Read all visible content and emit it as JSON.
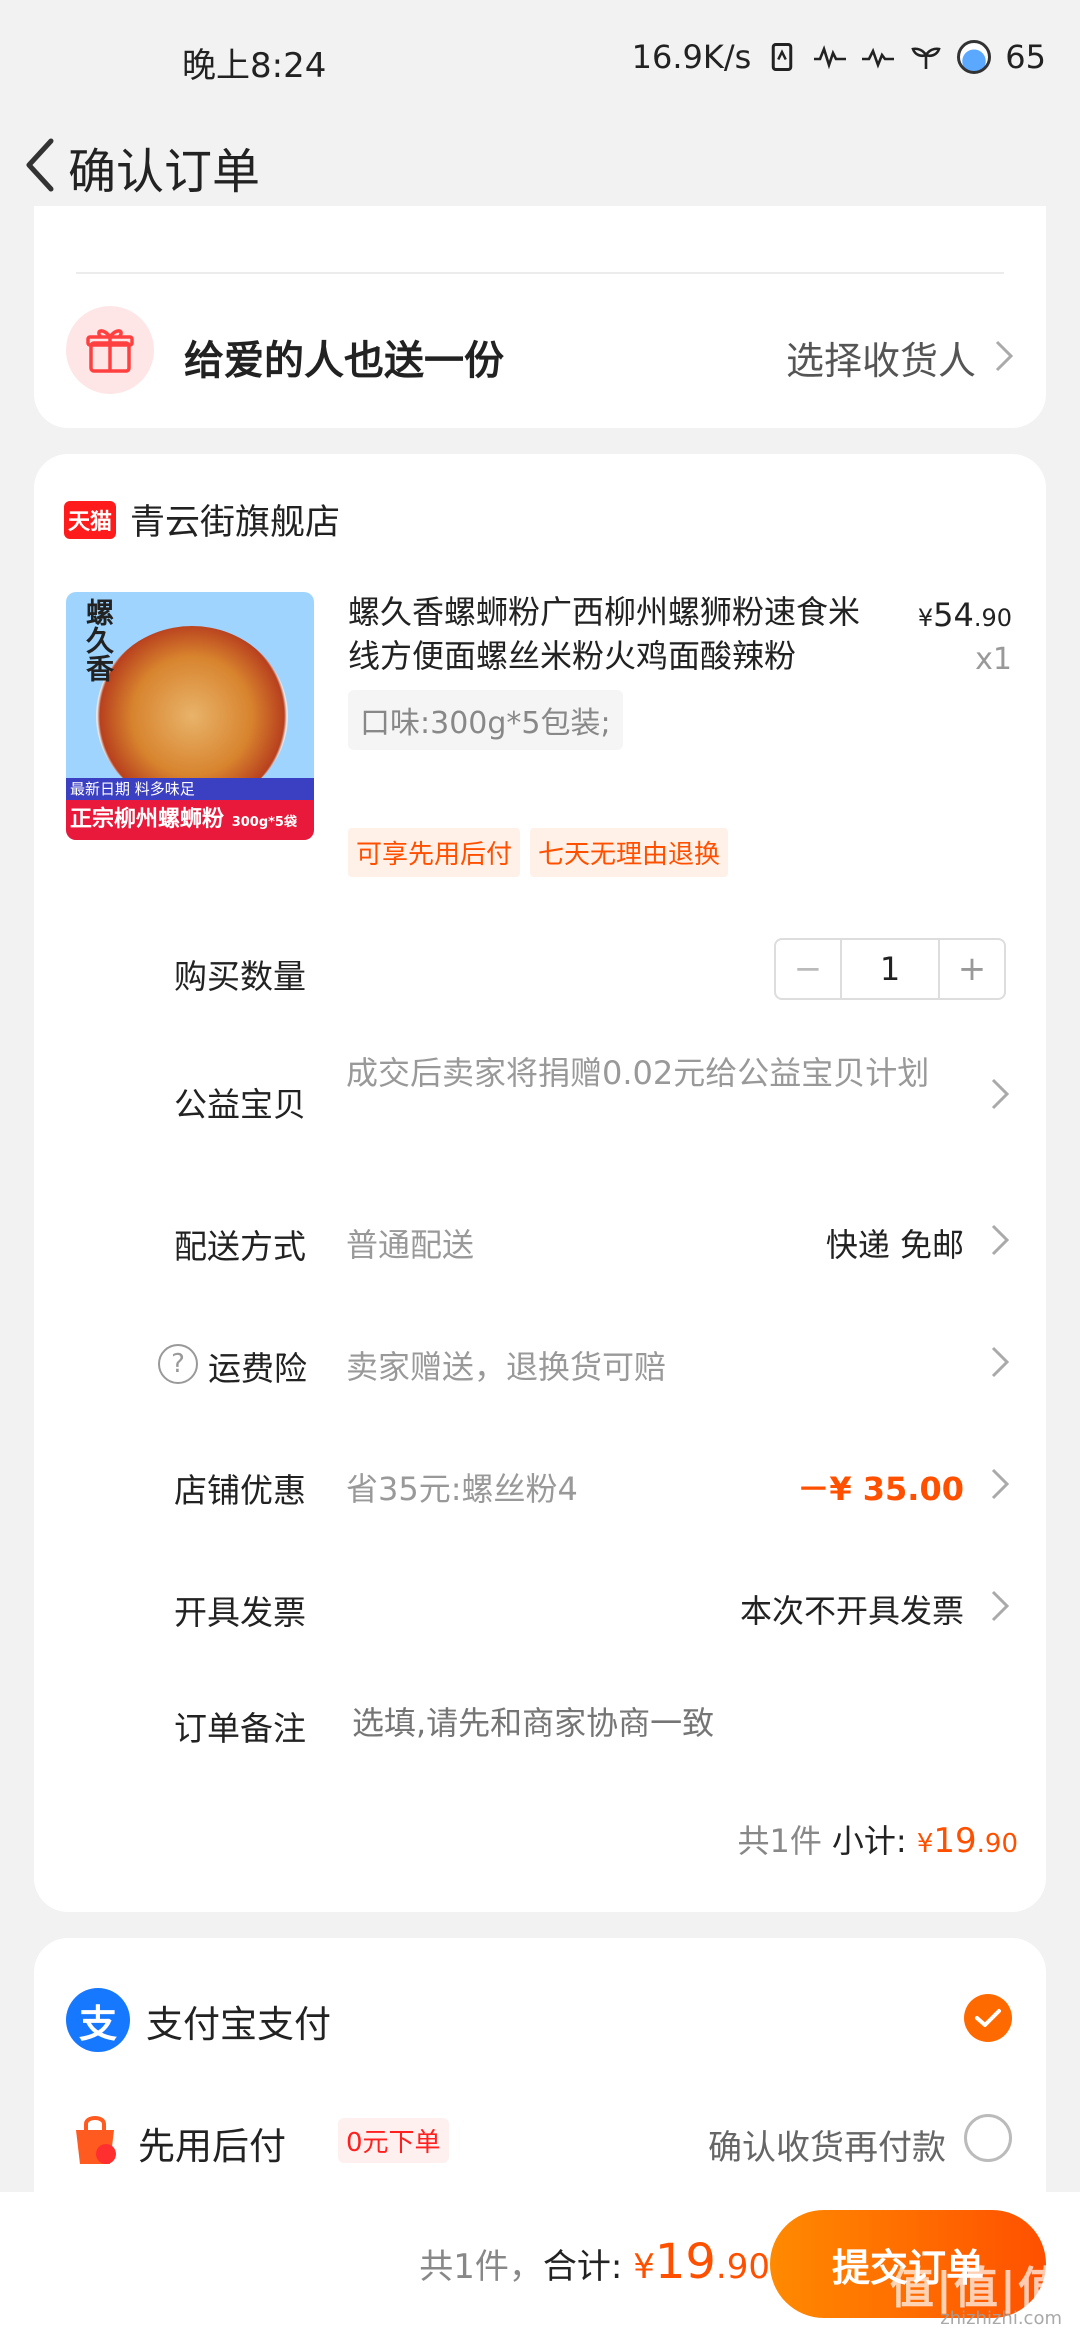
{
  "status_bar": {
    "time": "晚上8:24",
    "net_speed": "16.9K/s",
    "battery": "65"
  },
  "header": {
    "title": "确认订单"
  },
  "gift": {
    "title": "给爱的人也送一份",
    "action": "选择收货人"
  },
  "shop": {
    "badge": "天猫",
    "name": "青云街旗舰店"
  },
  "product": {
    "image_logo": "螺久香",
    "image_tag1": "最新日期 料多味足",
    "image_tag2": "正宗柳州螺蛳粉",
    "image_tag2_small": "300g*5袋",
    "title": "螺久香螺蛳粉广西柳州螺狮粉速食米线方便面螺丝米粉火鸡面酸辣粉",
    "price_symbol": "¥",
    "price_int": "54",
    "price_dec": ".90",
    "quantity": "x1",
    "spec": "口味:300g*5包装;",
    "tags": [
      "可享先用后付",
      "七天无理由退换"
    ]
  },
  "rows": {
    "qty_label": "购买数量",
    "qty_value": "1",
    "qty_minus": "−",
    "qty_plus": "+",
    "charity_label": "公益宝贝",
    "charity_value": "成交后卖家将捐赠0.02元给公益宝贝计划",
    "delivery_label": "配送方式",
    "delivery_value": "普通配送",
    "delivery_right": "快递 免邮",
    "insurance_help": "?",
    "insurance_label": "运费险",
    "insurance_value": "卖家赠送，退换货可赔",
    "discount_label": "店铺优惠",
    "discount_value": "省35元:螺丝粉4",
    "discount_right": "－¥ 35.00",
    "invoice_label": "开具发票",
    "invoice_right": "本次不开具发票",
    "note_label": "订单备注",
    "note_placeholder": "选填,请先和商家协商一致"
  },
  "subtotal": {
    "count": "共1件",
    "label": "小计:",
    "yen": "¥",
    "int": "19",
    "dec": ".90"
  },
  "payment": {
    "alipay_icon": "支",
    "alipay_label": "支付宝支付",
    "bnpl_label": "先用后付",
    "bnpl_badge": "0元下单",
    "bnpl_right": "确认收货再付款"
  },
  "bottom": {
    "count": "共1件，",
    "label": "合计:",
    "yen": "¥",
    "int": "19",
    "dec": ".90",
    "submit": "提交订单",
    "watermark": "值|值|值",
    "watermark_url": "zhizhizhi.com"
  },
  "colors": {
    "accent": "#ff5000",
    "alipay": "#1677ff",
    "tmall": "#ff1b1b"
  }
}
